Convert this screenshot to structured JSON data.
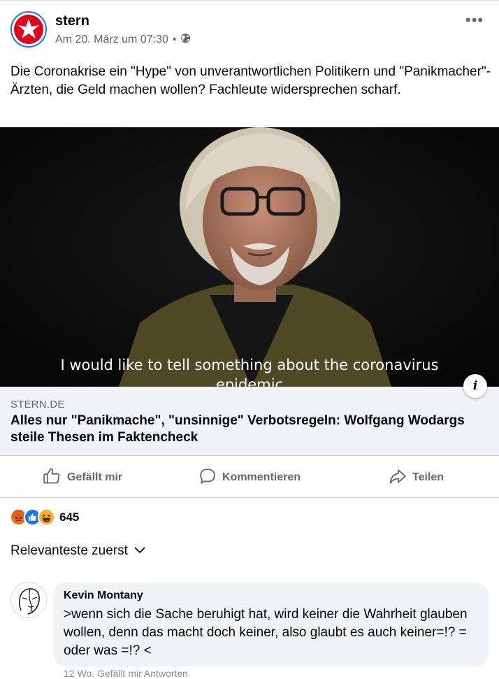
{
  "post": {
    "page_name": "stern",
    "timestamp": "Am 20. März um 07:30",
    "separator": "•",
    "audience_icon": "globe-icon",
    "more_icon": "more-options-icon",
    "caption": "Die Coronakrise ein \"Hype\" von unverantwortlichen Politikern und \"Panikmacher\"-Ärzten, die Geld machen wollen? Fachleute widersprechen scharf."
  },
  "media": {
    "subtitle_line1": "I would like to tell something about the coronavirus",
    "subtitle_line2": "epidemic"
  },
  "link": {
    "domain": "STERN.DE",
    "title": "Alles nur \"Panikmache\", \"unsinnige\" Verbotsregeln: Wolfgang Wodargs steile Thesen im Faktencheck",
    "info_label": "i"
  },
  "actions": {
    "like": "Gefällt mir",
    "comment": "Kommentieren",
    "share": "Teilen"
  },
  "reactions": {
    "count": "645",
    "types": [
      "angry",
      "like",
      "haha"
    ],
    "colors": {
      "angry": "#e9710f",
      "like": "#1877f2",
      "haha": "#f7b125"
    }
  },
  "comments": {
    "sort_label": "Relevanteste zuerst",
    "items": [
      {
        "author": "Kevin Montany",
        "text": ">wenn sich die Sache beruhigt hat, wird keiner die Wahrheit glauben wollen, denn das macht doch keiner, also glaubt es auch keiner=!? = oder was =!? <",
        "meta": "12 Wo.   Gefällt mir   Antworten"
      }
    ]
  },
  "colors": {
    "brand_red": "#e2001a",
    "facebook_blue": "#1877f2",
    "secondary_text": "#65676b"
  }
}
